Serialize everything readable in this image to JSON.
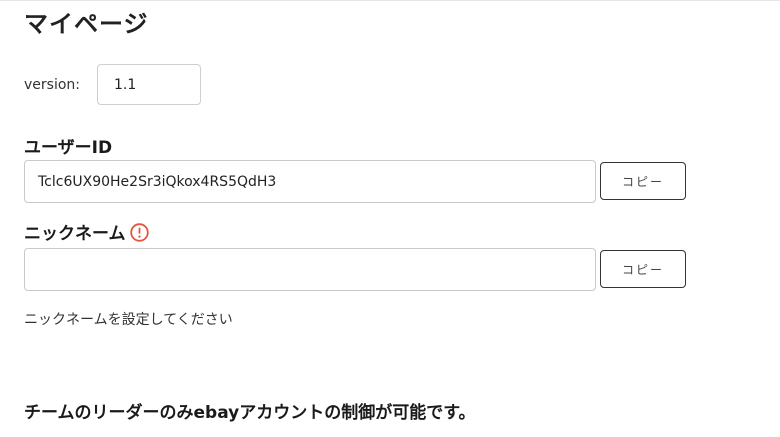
{
  "page": {
    "title": "マイページ"
  },
  "version": {
    "label": "version:",
    "value": "1.1"
  },
  "user_id": {
    "label": "ユーザーID",
    "value": "Tclc6UX90He2Sr3iQkox4RS5QdH3",
    "copy_label": "コピー"
  },
  "nickname": {
    "label": "ニックネーム",
    "value": "",
    "placeholder": "",
    "copy_label": "コピー",
    "hint": "ニックネームを設定してください",
    "warning_color": "#e2553f"
  },
  "notice": "チームのリーダーのみebayアカウントの制御が可能です。"
}
